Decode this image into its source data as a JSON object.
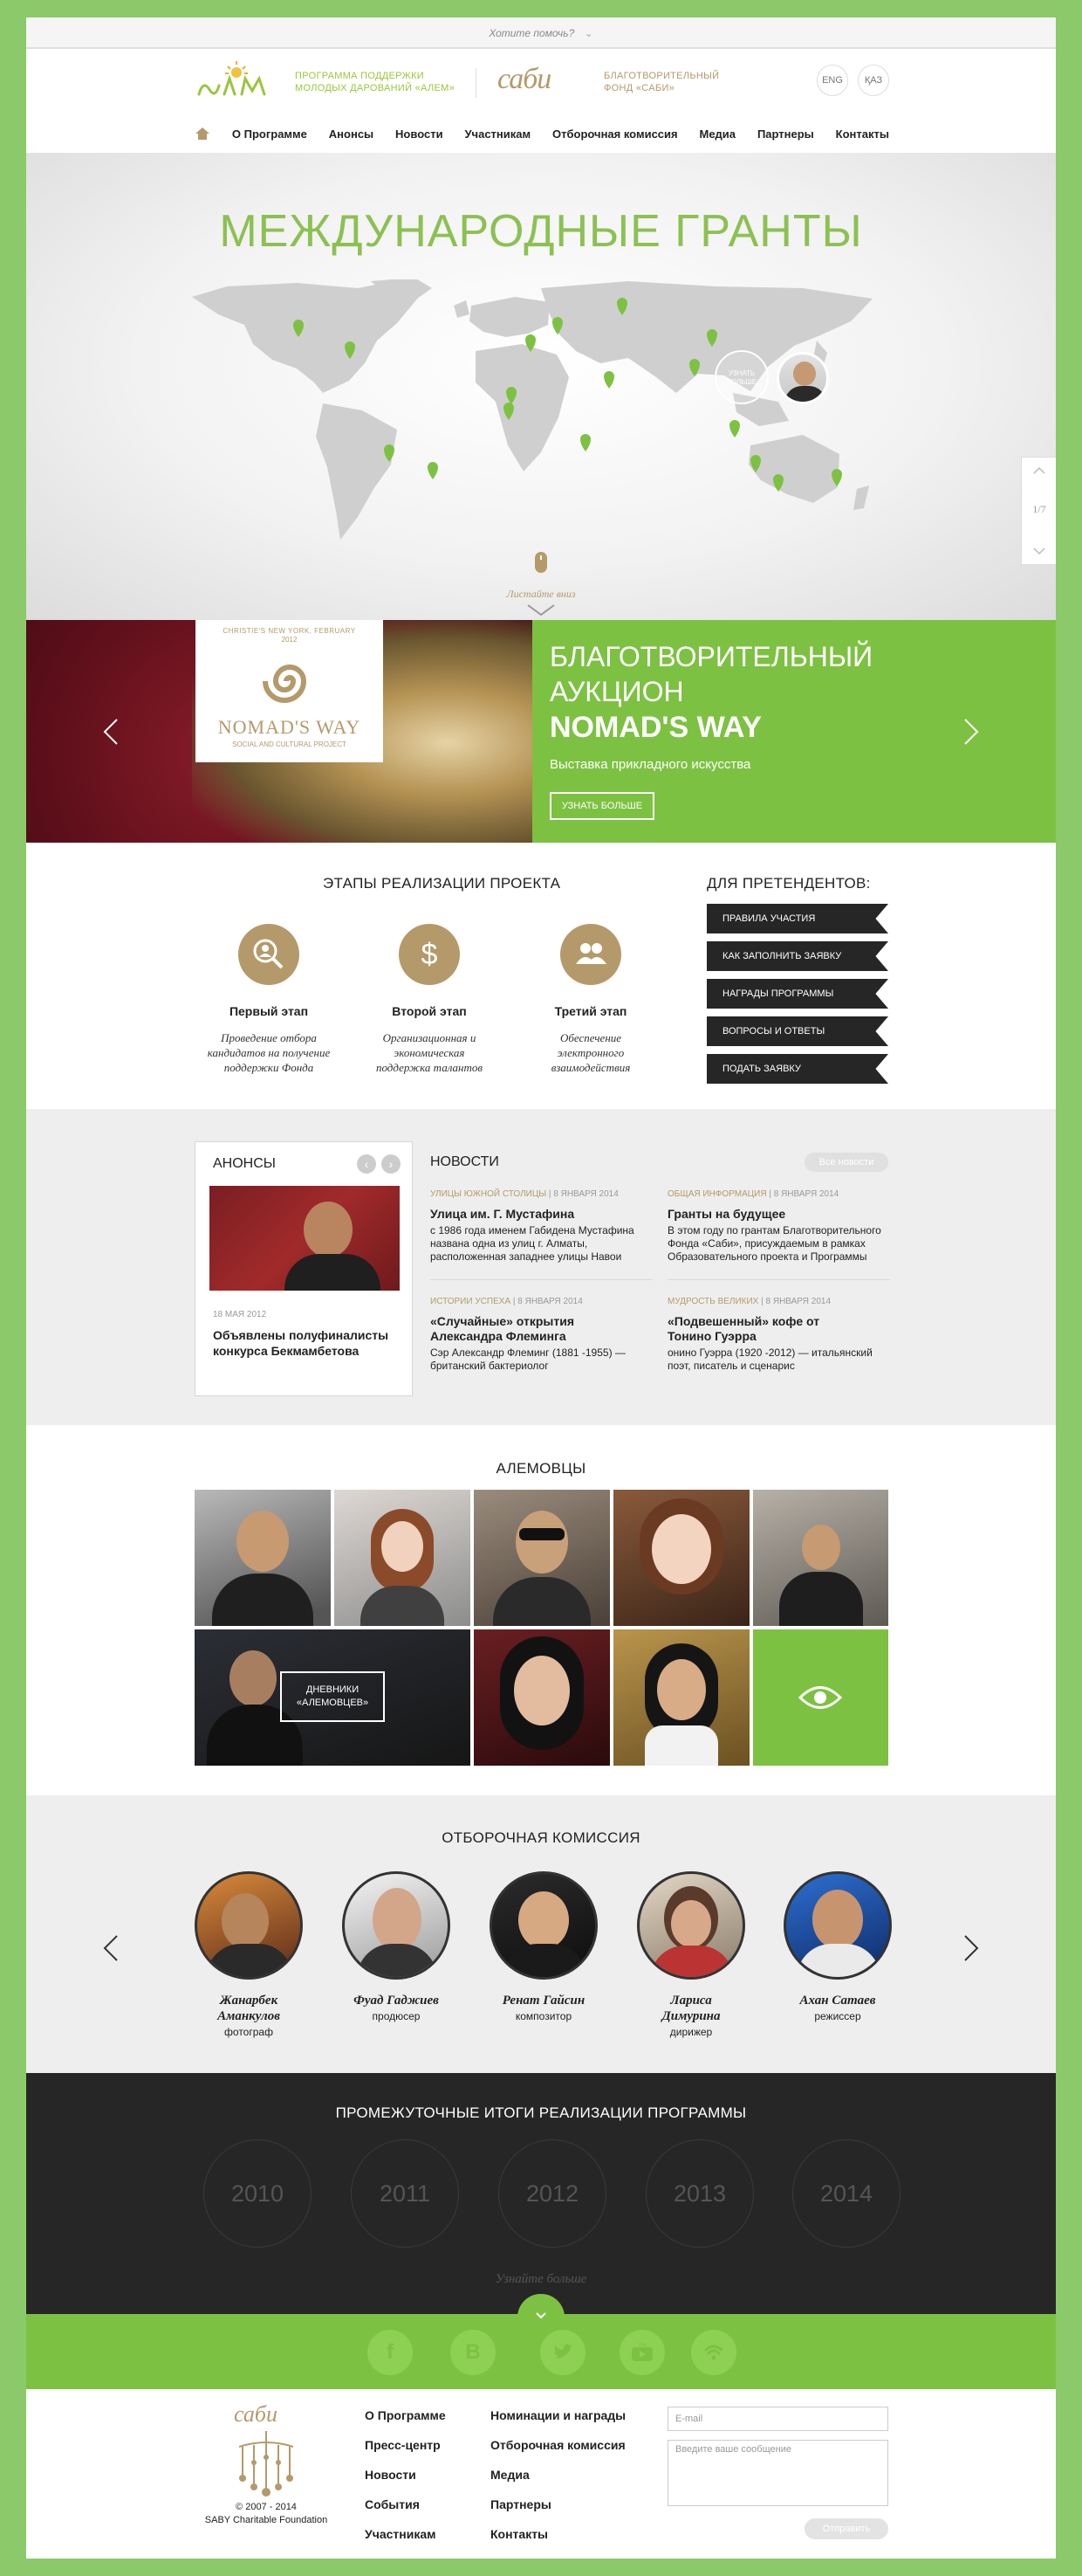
{
  "helpbar": {
    "text": "Хотите помочь?"
  },
  "header": {
    "alem_text": [
      "ПРОГРАММА ПОДДЕРЖКИ",
      "МОЛОДЫХ ДАРОВАНИЙ «АЛЕМ»"
    ],
    "saby_logo": "сабu",
    "saby_text": [
      "БЛАГОТВОРИТЕЛЬНЫЙ",
      "ФОНД «САБИ»"
    ],
    "lang": [
      "ENG",
      "ҚАЗ"
    ]
  },
  "nav": [
    "О Программе",
    "Анонсы",
    "Новости",
    "Участникам",
    "Отборочная комиссия",
    "Медиа",
    "Партнеры",
    "Контакты"
  ],
  "hero": {
    "title": "МЕЖДУНАРОДНЫЕ ГРАНТЫ",
    "popup_label": [
      "УЗНАТЬ",
      "БОЛЬШЕ"
    ],
    "scroll_hint": "Листайте вниз",
    "page_indicator": "1/7"
  },
  "slider": {
    "badge_top": [
      "CHRISTIE'S NEW YORK, FEBRUARY",
      "2012"
    ],
    "badge_logo": "NOMAD'S WAY",
    "badge_sub": "SOCIAL AND CULTURAL PROJECT",
    "title_1": "БЛАГОТВОРИТЕЛЬНЫЙ",
    "title_2": "АУКЦИОН",
    "title_3": "NOMAD'S WAY",
    "subtitle": "Выставка прикладного искусства",
    "button": "УЗНАТЬ БОЛЬШЕ"
  },
  "stages": {
    "title": "ЭТАПЫ РЕАЛИЗАЦИИ ПРОЕКТА",
    "items": [
      {
        "name": "Первый этап",
        "desc": [
          "Проведение отбора",
          "кандидатов на получение",
          "поддержки Фонда"
        ]
      },
      {
        "name": "Второй этап",
        "desc": [
          "Организационная и",
          "экономическая",
          "поддержка талантов"
        ]
      },
      {
        "name": "Третий этап",
        "desc": [
          "Обеспечение",
          "электронного",
          "взаимодействия"
        ]
      }
    ]
  },
  "applicants": {
    "title": "ДЛЯ ПРЕТЕНДЕНТОВ:",
    "links": [
      "ПРАВИЛА УЧАСТИЯ",
      "КАК ЗАПОЛНИТЬ ЗАЯВКУ",
      "НАГРАДЫ ПРОГРАММЫ",
      "ВОПРОСЫ И ОТВЕТЫ",
      "ПОДАТЬ ЗАЯВКУ"
    ]
  },
  "announce": {
    "title": "АНОНСЫ",
    "date": "18 МАЯ 2012",
    "headline": [
      "Объявлены полуфиналисты",
      "конкурса Бекмамбетова"
    ]
  },
  "news": {
    "title": "НОВОСТИ",
    "all_button": "Все новости",
    "items": [
      {
        "cat": "УЛИЦЫ ЮЖНОЙ СТОЛИЦЫ",
        "date": "8 ЯНВАРЯ 2014",
        "title": [
          "Улица им. Г. Мустафина"
        ],
        "text": [
          "с 1986 года именем Габидена Мустафина",
          "названа одна из улиц г. Алматы,",
          "расположенная западнее улицы Навои"
        ]
      },
      {
        "cat": "ОБЩАЯ ИНФОРМАЦИЯ",
        "date": "8 ЯНВАРЯ 2014",
        "title": [
          "Гранты на будущее"
        ],
        "text": [
          "В этом году по грантам Благотворительного",
          "Фонда «Саби», присуждаемым в рамках",
          "Образовательного проекта и Программы"
        ]
      },
      {
        "cat": "ИСТОРИИ УСПЕХА",
        "date": "8 ЯНВАРЯ 2014",
        "title": [
          "«Случайные» открытия",
          "Александра Флеминга"
        ],
        "text": [
          "Сэр Александр Флеминг (1881 -1955) —",
          "британский бактериолог"
        ]
      },
      {
        "cat": "МУДРОСТЬ ВЕЛИКИХ",
        "date": "8 ЯНВАРЯ 2014",
        "title": [
          "«Подвешенный» кофе от",
          "Тонино Гуэрра"
        ],
        "text": [
          "онино Гуэрра (1920 -2012) — итальянский",
          "поэт, писатель и сценарис"
        ]
      }
    ]
  },
  "alem": {
    "title": "АЛЕМОВЦЫ",
    "diary_button": [
      "ДНЕВНИКИ",
      "«АЛЕМОВЦЕВ»"
    ]
  },
  "commission": {
    "title": "ОТБОРОЧНАЯ КОМИССИЯ",
    "members": [
      {
        "name": [
          "Жанарбек",
          "Аманкулов"
        ],
        "role": "фотограф"
      },
      {
        "name": [
          "Фуад Гаджиев"
        ],
        "role": "продюсер"
      },
      {
        "name": [
          "Ренат Гайсин"
        ],
        "role": "композитор"
      },
      {
        "name": [
          "Лариса",
          "Димурина"
        ],
        "role": "дирижер"
      },
      {
        "name": [
          "Ахан Сатаев"
        ],
        "role": "режиссер"
      }
    ]
  },
  "results": {
    "title": "ПРОМЕЖУТОЧНЫЕ ИТОГИ РЕАЛИЗАЦИИ ПРОГРАММЫ",
    "years": [
      "2010",
      "2011",
      "2012",
      "2013",
      "2014"
    ],
    "more": "Узнайте больше"
  },
  "footer": {
    "logo": "сабu",
    "copyright": "© 2007 - 2014",
    "org": "SABY Charitable Foundation",
    "col1": [
      "О Программе",
      "Пресс-центр",
      "Новости",
      "События",
      "Участникам"
    ],
    "col2": [
      "Номинации и награды",
      "Отборочная комиссия",
      "Медиа",
      "Партнеры",
      "Контакты"
    ],
    "email_placeholder": "E-mail",
    "message_placeholder": "Введите ваше сообщение",
    "send": "Отправить"
  },
  "colors": {
    "green": "#7dc142",
    "gold": "#b49a6a",
    "dark": "#262626",
    "grey": "#eeeeee"
  }
}
